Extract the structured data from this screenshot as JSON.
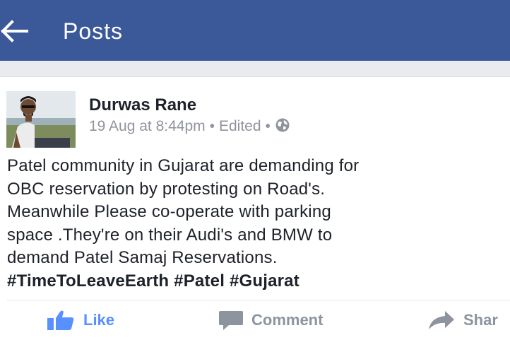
{
  "header": {
    "back_icon": "arrow-left-icon",
    "title": "Posts",
    "background_color": "#3b5998"
  },
  "post": {
    "author": "Durwas Rane",
    "date": "19 Aug at 8:44pm",
    "separator": "•",
    "edited": "Edited",
    "privacy_icon": "globe-icon",
    "body_lines": [
      "Patel community in Gujarat are demanding for",
      "OBC reservation by protesting on Road's.",
      "Meanwhile Please co-operate with parking",
      "space .They're on their Audi's and BMW to",
      "demand Patel Samaj Reservations."
    ],
    "hashtags": [
      "#TimeToLeaveEarth",
      "#Patel",
      "#Gujarat"
    ]
  },
  "actions": {
    "like": "Like",
    "comment": "Comment",
    "share": "Shar",
    "like_color": "#5890ff",
    "muted_color": "#8d949e"
  }
}
